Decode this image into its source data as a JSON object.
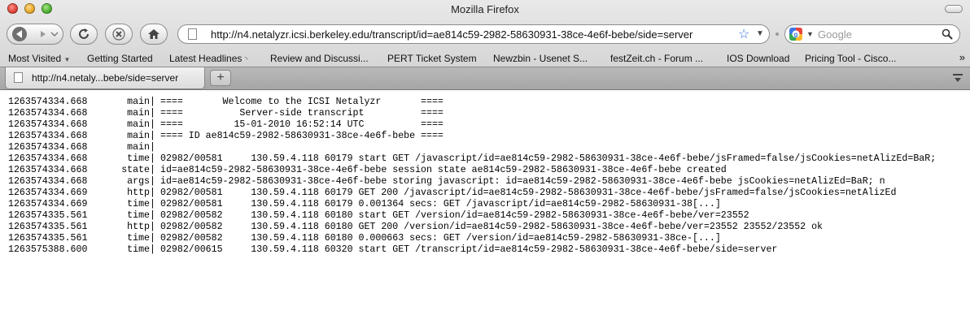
{
  "window": {
    "title": "Mozilla Firefox"
  },
  "toolbar": {
    "url": "http://n4.netalyzr.icsi.berkeley.edu/transcript/id=ae814c59-2982-58630931-38ce-4e6f-bebe/side=server",
    "search_placeholder": "Google"
  },
  "bookmarks": [
    "Most Visited",
    "Getting Started",
    "Latest Headlines",
    "Review and Discussi...",
    "PERT Ticket System",
    "Newzbin - Usenet S...",
    "festZeit.ch - Forum ...",
    "IOS Download",
    "Pricing Tool - Cisco..."
  ],
  "tabs": [
    {
      "label": "http://n4.netaly...bebe/side=server"
    }
  ],
  "new_tab_label": "+",
  "transcript": [
    {
      "ts": "1263574334.668",
      "mod": "main",
      "msg": "====       Welcome to the ICSI Netalyzr       ===="
    },
    {
      "ts": "1263574334.668",
      "mod": "main",
      "msg": "====          Server-side transcript          ===="
    },
    {
      "ts": "1263574334.668",
      "mod": "main",
      "msg": "====         15-01-2010 16:52:14 UTC          ===="
    },
    {
      "ts": "1263574334.668",
      "mod": "main",
      "msg": "==== ID ae814c59-2982-58630931-38ce-4e6f-bebe ===="
    },
    {
      "ts": "1263574334.668",
      "mod": "main",
      "msg": ""
    },
    {
      "ts": "1263574334.668",
      "mod": "time",
      "msg": "02982/00581     130.59.4.118 60179 start GET /javascript/id=ae814c59-2982-58630931-38ce-4e6f-bebe/jsFramed=false/jsCookies=netAlizEd=BaR;"
    },
    {
      "ts": "1263574334.668",
      "mod": "state",
      "msg": "id=ae814c59-2982-58630931-38ce-4e6f-bebe session state ae814c59-2982-58630931-38ce-4e6f-bebe created"
    },
    {
      "ts": "1263574334.668",
      "mod": "args",
      "msg": "id=ae814c59-2982-58630931-38ce-4e6f-bebe storing javascript: id=ae814c59-2982-58630931-38ce-4e6f-bebe jsCookies=netAlizEd=BaR; n"
    },
    {
      "ts": "1263574334.669",
      "mod": "http",
      "msg": "02982/00581     130.59.4.118 60179 GET 200 /javascript/id=ae814c59-2982-58630931-38ce-4e6f-bebe/jsFramed=false/jsCookies=netAlizEd"
    },
    {
      "ts": "1263574334.669",
      "mod": "time",
      "msg": "02982/00581     130.59.4.118 60179 0.001364 secs: GET /javascript/id=ae814c59-2982-58630931-38[...]"
    },
    {
      "ts": "1263574335.561",
      "mod": "time",
      "msg": "02982/00582     130.59.4.118 60180 start GET /version/id=ae814c59-2982-58630931-38ce-4e6f-bebe/ver=23552"
    },
    {
      "ts": "1263574335.561",
      "mod": "http",
      "msg": "02982/00582     130.59.4.118 60180 GET 200 /version/id=ae814c59-2982-58630931-38ce-4e6f-bebe/ver=23552 23552/23552 ok"
    },
    {
      "ts": "1263574335.561",
      "mod": "time",
      "msg": "02982/00582     130.59.4.118 60180 0.000663 secs: GET /version/id=ae814c59-2982-58630931-38ce-[...]"
    },
    {
      "ts": "1263575388.600",
      "mod": "time",
      "msg": "02982/00615     130.59.4.118 60320 start GET /transcript/id=ae814c59-2982-58630931-38ce-4e6f-bebe/side=server"
    }
  ]
}
